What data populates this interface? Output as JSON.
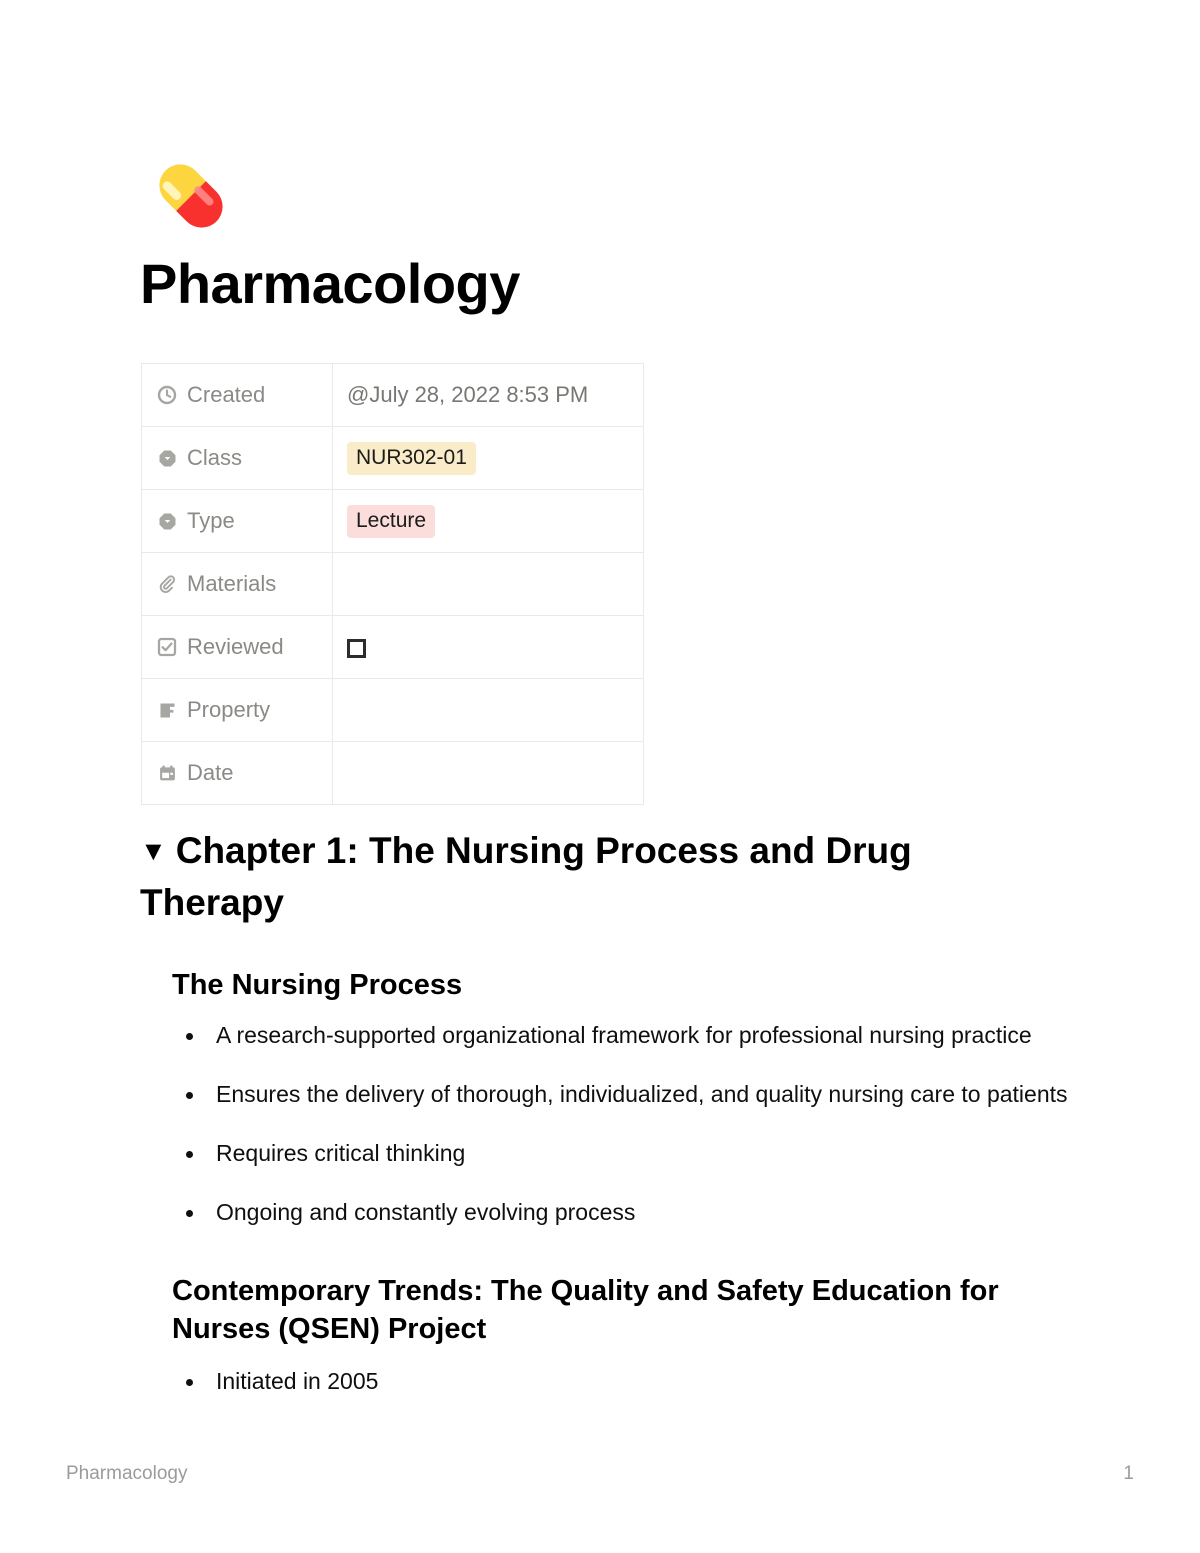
{
  "document": {
    "icon": "pill-emoji",
    "title": "Pharmacology"
  },
  "properties": {
    "rows": [
      {
        "icon": "clock-icon",
        "label": "Created",
        "value_type": "text",
        "value": "@July 28, 2022 8:53 PM"
      },
      {
        "icon": "select-icon",
        "label": "Class",
        "value_type": "badge",
        "value": "NUR302-01",
        "badge_color": "#faecc8"
      },
      {
        "icon": "select-icon",
        "label": "Type",
        "value_type": "badge",
        "value": "Lecture",
        "badge_color": "#fbdedb"
      },
      {
        "icon": "paperclip-icon",
        "label": "Materials",
        "value_type": "empty",
        "value": ""
      },
      {
        "icon": "checkbox-icon",
        "label": "Reviewed",
        "value_type": "checkbox",
        "value": "",
        "checked": false
      },
      {
        "icon": "text-icon",
        "label": "Property",
        "value_type": "empty",
        "value": ""
      },
      {
        "icon": "calendar-icon",
        "label": "Date",
        "value_type": "empty",
        "value": ""
      }
    ]
  },
  "content": {
    "chapter": {
      "toggle": "▼",
      "heading": "Chapter 1: The Nursing Process and Drug Therapy"
    },
    "section_1": {
      "heading": "The Nursing Process",
      "bullets": [
        "A research-supported organizational framework for professional nursing practice",
        "Ensures the delivery of thorough, individualized, and quality nursing care to patients",
        "Requires critical thinking",
        "Ongoing and constantly evolving process"
      ]
    },
    "section_2": {
      "heading": "Contemporary Trends: The Quality and Safety Education for Nurses (QSEN) Project",
      "bullets": [
        "Initiated in 2005"
      ]
    }
  },
  "footer": {
    "left": "Pharmacology",
    "right": "1"
  },
  "colors": {
    "text": "#0f0f0f",
    "muted": "#787774",
    "border": "#e9e9e7",
    "badge_class": "#faecc8",
    "badge_type": "#fbdedb",
    "pill_yellow": "#fcd53f",
    "pill_red": "#f8312f"
  }
}
